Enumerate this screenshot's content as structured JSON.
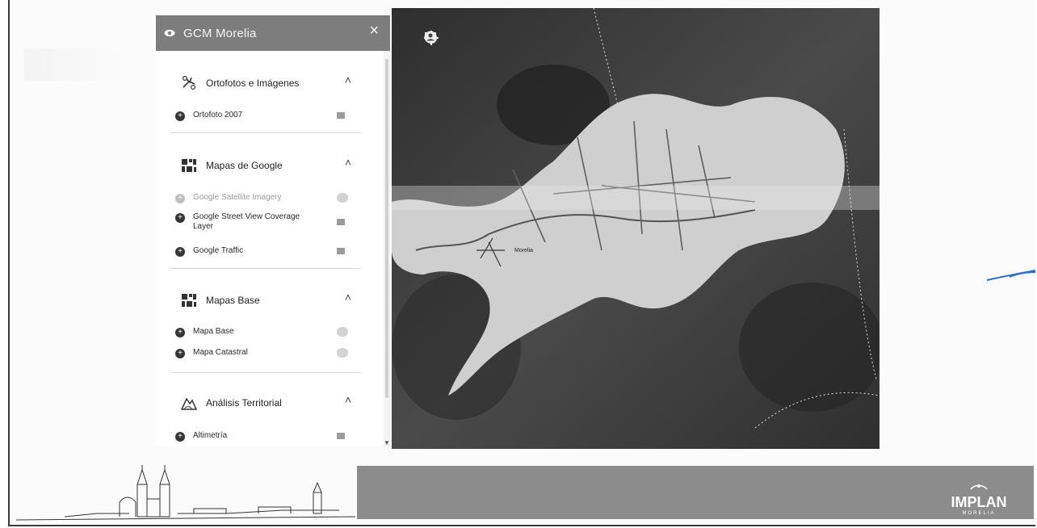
{
  "panel": {
    "title": "GCM Morelia",
    "close_glyph": "×",
    "sections": [
      {
        "title": "Ortofotos e Imágenes",
        "icon": "drone-icon",
        "items": [
          {
            "label": "Ortofoto 2007",
            "control": "square"
          }
        ]
      },
      {
        "title": "Mapas de Google",
        "icon": "grid-map-icon",
        "items": [
          {
            "label": "Google Satellite Imagery",
            "control": "dot",
            "dim": true
          },
          {
            "label": "Google Street View Coverage Layer",
            "control": "square"
          },
          {
            "label": "Google Traffic",
            "control": "square"
          }
        ]
      },
      {
        "title": "Mapas Base",
        "icon": "grid-map-icon",
        "items": [
          {
            "label": "Mapa Base",
            "control": "dot"
          },
          {
            "label": "Mapa Catastral",
            "control": "dot"
          }
        ]
      },
      {
        "title": "Análisis Territorial",
        "icon": "landscape-icon",
        "items": [
          {
            "label": "Altimetría",
            "control": "square"
          }
        ]
      }
    ]
  },
  "map": {
    "toolbar": [
      "ruler-icon",
      "locate-icon",
      "home-icon",
      "user-icon"
    ],
    "city_label": "Morelia"
  },
  "footer": {
    "logo_text": "IMPLAN",
    "logo_sub": "MORELIA"
  },
  "colors": {
    "header_bg": "#7d7d7d",
    "band_bg": "#8c8c8c",
    "map_dark": "#3a3a3a",
    "city_light": "#cfcfcf",
    "pen_blue": "#2f6fd0"
  }
}
